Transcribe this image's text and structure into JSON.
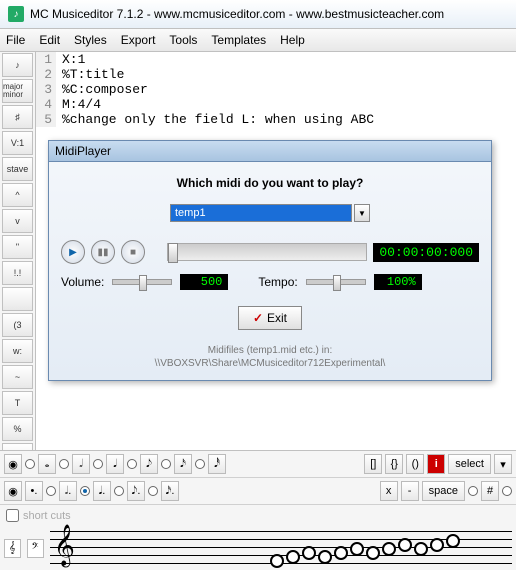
{
  "titlebar": {
    "icon_letter": "♪",
    "text": "MC Musiceditor 7.1.2 - www.mcmusiceditor.com - www.bestmusicteacher.com"
  },
  "menubar": [
    "File",
    "Edit",
    "Styles",
    "Export",
    "Tools",
    "Templates",
    "Help"
  ],
  "sidebar": [
    "♪",
    "major minor",
    "♯",
    "V:1",
    "stave",
    "^",
    "v",
    "\"",
    "!.!",
    "",
    "(3",
    "w:",
    "~",
    "T",
    "%",
    "♫",
    "□"
  ],
  "editor": {
    "lines": [
      {
        "n": "1",
        "text": "X:1",
        "cls": ""
      },
      {
        "n": "2",
        "text": "%T:title",
        "cls": "dir"
      },
      {
        "n": "3",
        "text": "%C:composer",
        "cls": "dir"
      },
      {
        "n": "4",
        "text": "M:4/4",
        "cls": ""
      },
      {
        "n": "5",
        "text": "%change only the field L: when using ABC",
        "cls": "dir"
      }
    ]
  },
  "dialog": {
    "title": "MidiPlayer",
    "question": "Which midi do you want to play?",
    "combo_value": "temp1",
    "time": "00:00:00:000",
    "volume_label": "Volume:",
    "volume_value": "500",
    "tempo_label": "Tempo:",
    "tempo_value": "100%",
    "exit_label": "Exit",
    "foot1": "Midifiles (temp1.mid etc.) in:",
    "foot2": "\\\\VBOXSVR\\Share\\MCMusiceditor712Experimental\\"
  },
  "toolbar2": {
    "brackets": [
      "[]",
      "{}",
      "()"
    ],
    "i_label": "i",
    "select_label": "select",
    "x_label": "x",
    "dash_label": "-",
    "space_label": "space",
    "sharp": "#"
  },
  "shortcuts_label": "short cuts"
}
